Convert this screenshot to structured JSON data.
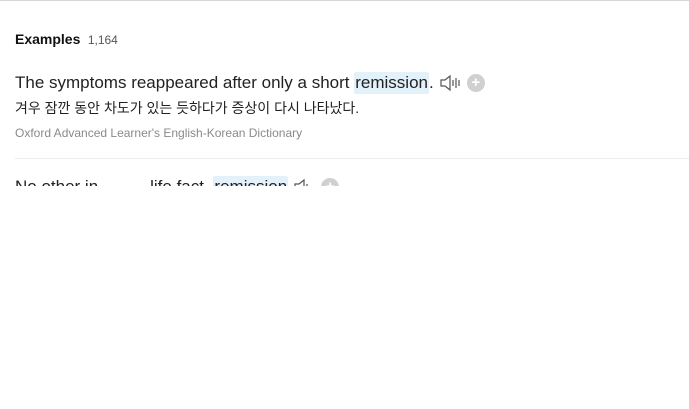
{
  "examples": {
    "title": "Examples",
    "count": "1,164",
    "items": [
      {
        "before": "The symptoms reappeared after only a short ",
        "highlight": "remission",
        "after": ".",
        "translation": "겨우 잠깐 동안 차도가 있는 듯하다가 증상이 다시 나타났다.",
        "source": "Oxford Advanced Learner's English-Korean Dictionary",
        "speaker_icon": "speaker-icon",
        "add_icon": "plus-circle-icon",
        "add_label": "+"
      },
      {
        "before": "No other in           life fact  ",
        "highlight": "remission",
        "after": "",
        "speaker_icon": "speaker-icon",
        "add_icon": "plus-circle-icon",
        "add_label": "+"
      }
    ]
  },
  "colors": {
    "highlight": "#e3f1fb",
    "source_text": "#8a8a8a",
    "add_icon_bg": "#d0d0d0"
  }
}
